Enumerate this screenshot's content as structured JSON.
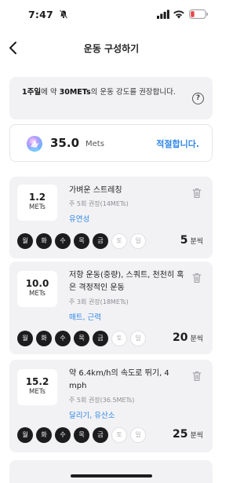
{
  "status": {
    "time": "7:47"
  },
  "nav": {
    "title": "운동 구성하기"
  },
  "info": {
    "highlight1": "1주일",
    "text1": "에 약 ",
    "highlight2": "30METs",
    "text2": "의 운동 강도를 권장합니다."
  },
  "summary": {
    "value": "35.0",
    "unit": "Mets",
    "verdict": "적절합니다."
  },
  "days_labels": [
    "월",
    "화",
    "수",
    "목",
    "금",
    "토",
    "일"
  ],
  "cards": [
    {
      "mets": "1.2",
      "mets_label": "METs",
      "name": "가벼운 스트레칭",
      "sub": "주 5회 권장(14METs)",
      "tag": "유연성",
      "days_active": [
        true,
        true,
        true,
        true,
        true,
        false,
        false
      ],
      "minutes": "5",
      "minutes_unit": "분씩"
    },
    {
      "mets": "10.0",
      "mets_label": "METs",
      "name": "저항 운동(중량), 스쿼트, 천천히 혹은 격정적인 운동",
      "sub": "주 3회 권장(18METs)",
      "tag": "매트, 근력",
      "days_active": [
        true,
        true,
        true,
        true,
        true,
        false,
        false
      ],
      "minutes": "20",
      "minutes_unit": "분씩"
    },
    {
      "mets": "15.2",
      "mets_label": "METs",
      "name": "약 6.4km/h의 속도로 뛰기, 4 mph",
      "sub": "주 5회 권장(36.5METs)",
      "tag": "달리기, 유산소",
      "days_active": [
        true,
        true,
        true,
        true,
        true,
        false,
        false
      ],
      "minutes": "25",
      "minutes_unit": "분씩"
    }
  ],
  "colors": {
    "accent": "#2f86e8",
    "card_bg": "#f2f2f4",
    "day_on": "#1c1c1e",
    "battery": "#e5484d"
  }
}
